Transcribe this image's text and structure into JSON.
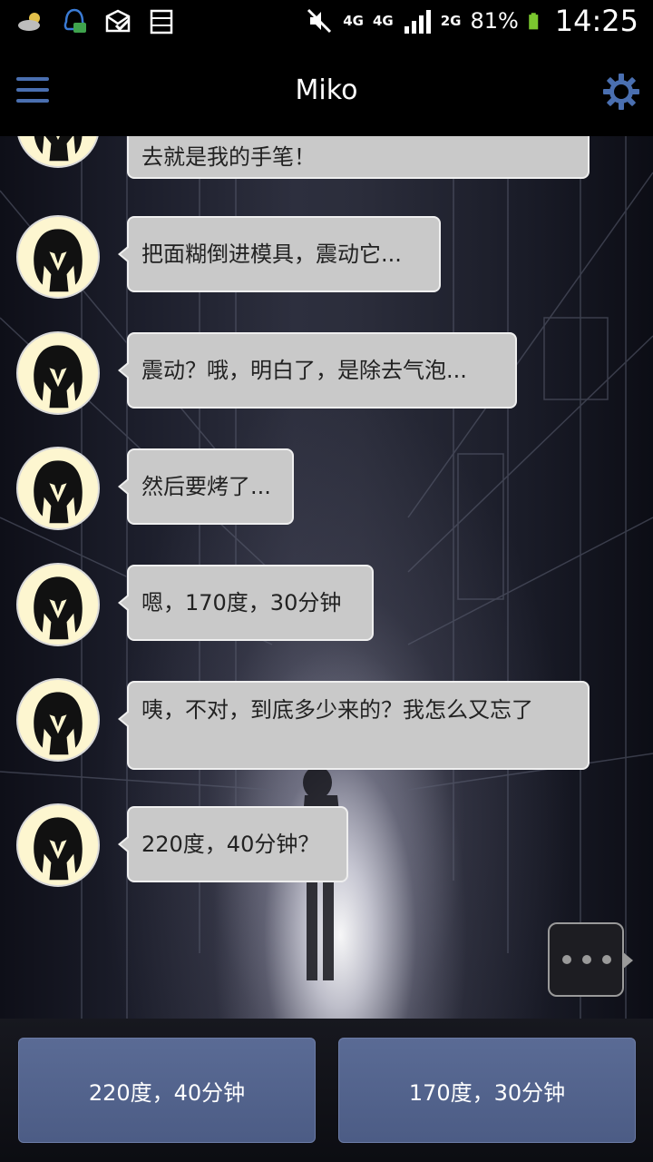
{
  "status_bar": {
    "net_labels": [
      "4G",
      "4G",
      "2G"
    ],
    "battery_percent": "81%",
    "time": "14:25",
    "icons": [
      "weather-icon",
      "qq-icon",
      "mail-icon",
      "storage-icon",
      "mute-icon",
      "signal-icon",
      "battery-icon"
    ]
  },
  "header": {
    "title": "Miko",
    "left_icon": "menu-icon",
    "right_icon": "gear-icon"
  },
  "messages": [
    {
      "text": "去就是我的手笔！"
    },
    {
      "text": "把面糊倒进模具，震动它..."
    },
    {
      "text": "震动？哦，明白了，是除去气泡..."
    },
    {
      "text": "然后要烤了..."
    },
    {
      "text": "嗯，170度，30分钟"
    },
    {
      "text": "咦，不对，到底多少来的？我怎么又忘了"
    },
    {
      "text": "220度，40分钟？"
    }
  ],
  "choices": [
    {
      "label": "220度，40分钟"
    },
    {
      "label": "170度，30分钟"
    }
  ],
  "colors": {
    "accent": "#4a6fb0",
    "bubble": "#c9c9c9",
    "choice": "#55658f"
  }
}
